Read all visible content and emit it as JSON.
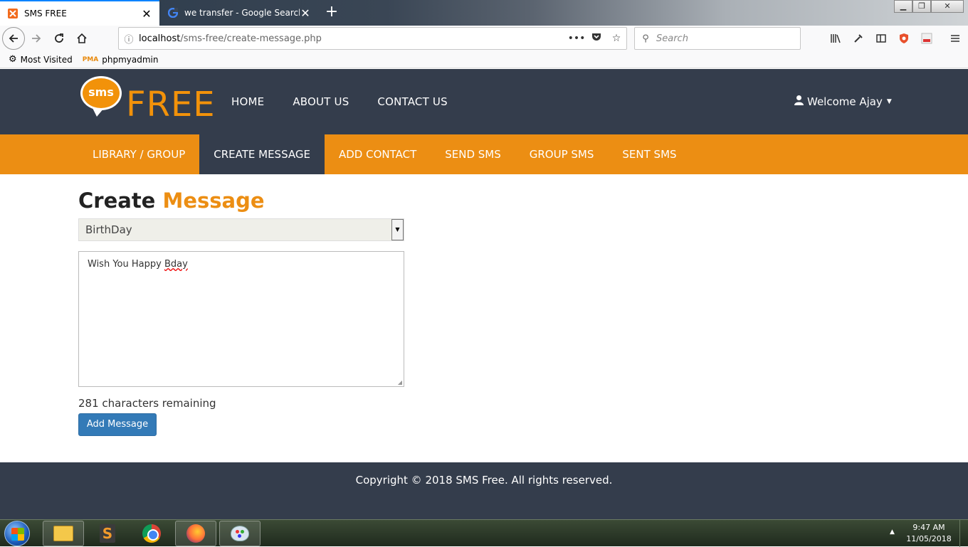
{
  "browser": {
    "tabs": [
      {
        "title": "SMS FREE",
        "favicon": "xampp-icon",
        "active": true
      },
      {
        "title": "we transfer - Google Search",
        "favicon": "google-icon",
        "active": false
      }
    ],
    "new_tab": "+",
    "window_buttons": {
      "minimize": "▁",
      "restore": "❐",
      "close": "✕"
    },
    "url": {
      "host": "localhost",
      "path": "/sms-free/create-message.php"
    },
    "url_actions": {
      "more": "•••"
    },
    "search_placeholder": "Search",
    "bookmarks": [
      {
        "label": "Most Visited",
        "icon": "gear-icon"
      },
      {
        "label": "phpmyadmin",
        "icon": "phpmyadmin-icon"
      }
    ],
    "pma_label": "PMA"
  },
  "site": {
    "logo": {
      "bubble": "sms",
      "word": "FREE"
    },
    "nav": [
      "HOME",
      "ABOUT US",
      "CONTACT US"
    ],
    "user": {
      "label": "Welcome Ajay"
    },
    "subnav": [
      {
        "label": "LIBRARY / GROUP",
        "active": false
      },
      {
        "label": "CREATE MESSAGE",
        "active": true
      },
      {
        "label": "ADD CONTACT",
        "active": false
      },
      {
        "label": "SEND SMS",
        "active": false
      },
      {
        "label": "GROUP SMS",
        "active": false
      },
      {
        "label": "SENT SMS",
        "active": false
      }
    ],
    "heading": {
      "part1": "Create",
      "part2": "Message"
    },
    "form": {
      "select_value": "BirthDay",
      "message_plain": "Wish You Happy ",
      "message_misspelled": "Bday",
      "counter": "281 characters remaining",
      "submit": "Add Message"
    },
    "footer": "Copyright © 2018 SMS Free. All rights reserved."
  },
  "taskbar": {
    "apps": [
      "windows-explorer",
      "sublime-text",
      "google-chrome",
      "firefox",
      "paint"
    ],
    "sublime_letter": "S",
    "time": "9:47 AM",
    "date": "11/05/2018"
  },
  "colors": {
    "header_bg": "#343d4c",
    "accent_orange": "#ec8e13",
    "button_blue": "#337ab7"
  }
}
